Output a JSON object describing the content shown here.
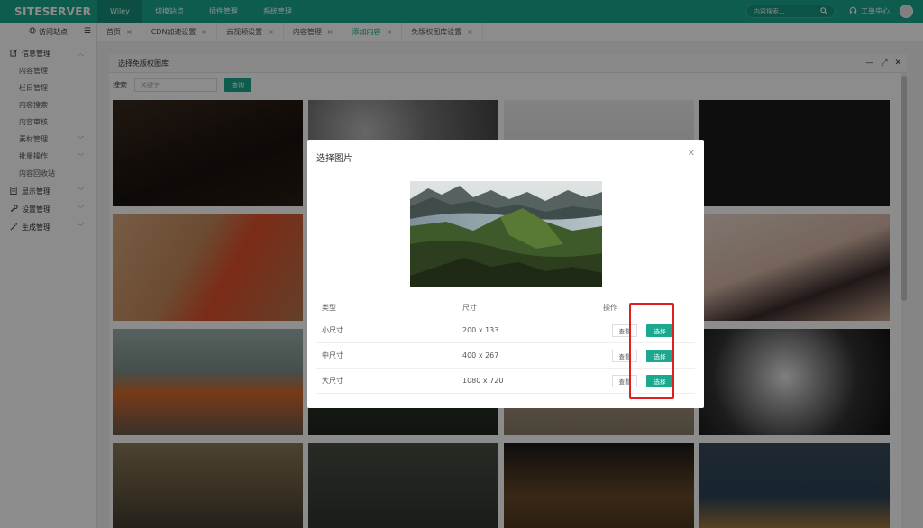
{
  "topbar": {
    "logo": "SITESERVER",
    "nav": [
      "Wiley",
      "切换站点",
      "插件管理",
      "系统管理"
    ],
    "search_placeholder": "内容搜索...",
    "workorder": "工单中心"
  },
  "sidebar": {
    "visit": "访问站点",
    "items": [
      {
        "label": "信息管理",
        "icon": "edit-icon",
        "expanded": true
      },
      {
        "label": "内容管理"
      },
      {
        "label": "栏目管理"
      },
      {
        "label": "内容搜索"
      },
      {
        "label": "内容审核"
      },
      {
        "label": "素材管理"
      },
      {
        "label": "批量操作"
      },
      {
        "label": "内容回收站"
      },
      {
        "label": "显示管理",
        "icon": "doc-icon"
      },
      {
        "label": "设置管理",
        "icon": "wrench-icon"
      },
      {
        "label": "生成管理",
        "icon": "magic-icon"
      }
    ]
  },
  "tabs": [
    {
      "label": "首页"
    },
    {
      "label": "CDN加速设置"
    },
    {
      "label": "云视频设置"
    },
    {
      "label": "内容管理"
    },
    {
      "label": "添加内容",
      "active": true
    },
    {
      "label": "免版权图库设置"
    }
  ],
  "library": {
    "title": "选择免版权图库",
    "search_label": "搜索",
    "search_placeholder": "关键字",
    "search_button": "查询"
  },
  "dialog": {
    "title": "选择图片",
    "columns": [
      "类型",
      "尺寸",
      "操作"
    ],
    "rows": [
      {
        "type": "小尺寸",
        "size": "200 x 133",
        "view": "查看",
        "select": "选择"
      },
      {
        "type": "中尺寸",
        "size": "400 x 267",
        "view": "查看",
        "select": "选择"
      },
      {
        "type": "大尺寸",
        "size": "1080 x 720",
        "view": "查看",
        "select": "选择"
      }
    ]
  },
  "colors": {
    "brand": "#1ba88e",
    "highlight": "#e02020"
  }
}
